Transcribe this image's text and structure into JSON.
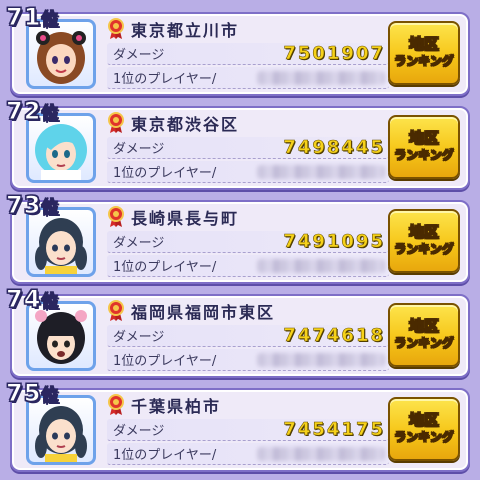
{
  "rankings": [
    {
      "rank": "71",
      "rank_suffix": "位",
      "region": "東京都立川市",
      "damage_label": "ダメージ",
      "damage": "7501907",
      "top_player_label": "1位のプレイヤー/",
      "button_line1": "地区",
      "button_line2": "ランキング",
      "avatar_icon": "character-portrait-brown-hair-icon"
    },
    {
      "rank": "72",
      "rank_suffix": "位",
      "region": "東京都渋谷区",
      "damage_label": "ダメージ",
      "damage": "7498445",
      "top_player_label": "1位のプレイヤー/",
      "button_line1": "地区",
      "button_line2": "ランキング",
      "avatar_icon": "character-portrait-cyan-hair-icon"
    },
    {
      "rank": "73",
      "rank_suffix": "位",
      "region": "長崎県長与町",
      "damage_label": "ダメージ",
      "damage": "7491095",
      "top_player_label": "1位のプレイヤー/",
      "button_line1": "地区",
      "button_line2": "ランキング",
      "avatar_icon": "character-portrait-braid-hair-icon"
    },
    {
      "rank": "74",
      "rank_suffix": "位",
      "region": "福岡県福岡市東区",
      "damage_label": "ダメージ",
      "damage": "7474618",
      "top_player_label": "1位のプレイヤー/",
      "button_line1": "地区",
      "button_line2": "ランキング",
      "avatar_icon": "character-portrait-black-hair-icon"
    },
    {
      "rank": "75",
      "rank_suffix": "位",
      "region": "千葉県柏市",
      "damage_label": "ダメージ",
      "damage": "7454175",
      "top_player_label": "1位のプレイヤー/",
      "button_line1": "地区",
      "button_line2": "ランキング",
      "avatar_icon": "character-portrait-braid-hair-icon"
    }
  ],
  "colors": {
    "background": "#b9aee6",
    "card": "#efeaf8",
    "card_border": "#7e6fc7",
    "damage_value": "#f6d21a",
    "button": "#f6c619",
    "medal": "#e0332b"
  }
}
